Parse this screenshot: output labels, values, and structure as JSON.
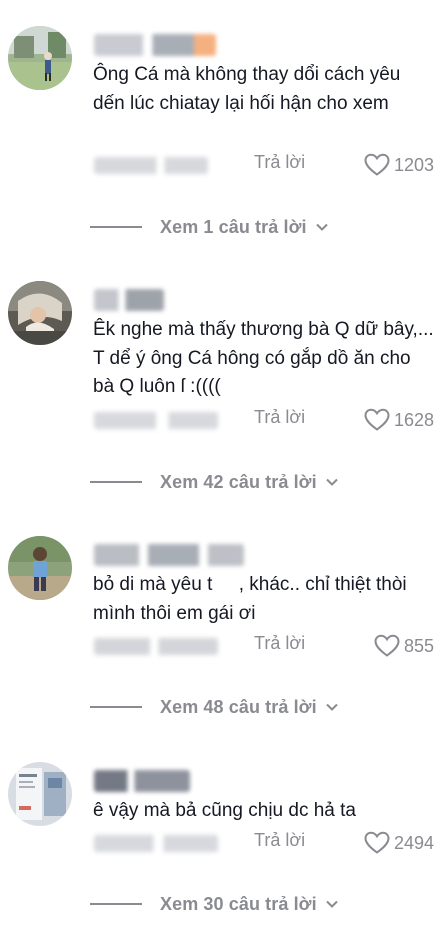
{
  "comments": [
    {
      "text": "Ông Cá mà không thay dổi cách yêu dến lúc chiatay lại hối hận cho xem",
      "reply_label": "Trả lời",
      "likes": "1203",
      "view_replies": "Xem 1 câu trả lời"
    },
    {
      "text": "Êk nghe mà thấy thương bà Q dữ bây,... T dể ý ông Cá hông có gắp dồ ăn cho bà Q luôn ſ :((((",
      "reply_label": "Trả lời",
      "likes": "1628",
      "view_replies": "Xem 42 câu trả lời"
    },
    {
      "text": "bỏ di mà yêu t     , khác.. chỉ thiệt thòi mình thôi em gái ơi",
      "reply_label": "Trả lời",
      "likes": "855",
      "view_replies": "Xem 48 câu trả lời"
    },
    {
      "text": "ê vậy mà bả cũng chịu dc hả ta",
      "reply_label": "Trả lời",
      "likes": "2494",
      "view_replies": "Xem 30 câu trả lời"
    }
  ],
  "icons": {
    "like": "heart-outline-icon",
    "expand": "chevron-down-icon"
  },
  "colors": {
    "text": "#161823",
    "secondary": "#8a8b91",
    "background": "#ffffff"
  }
}
